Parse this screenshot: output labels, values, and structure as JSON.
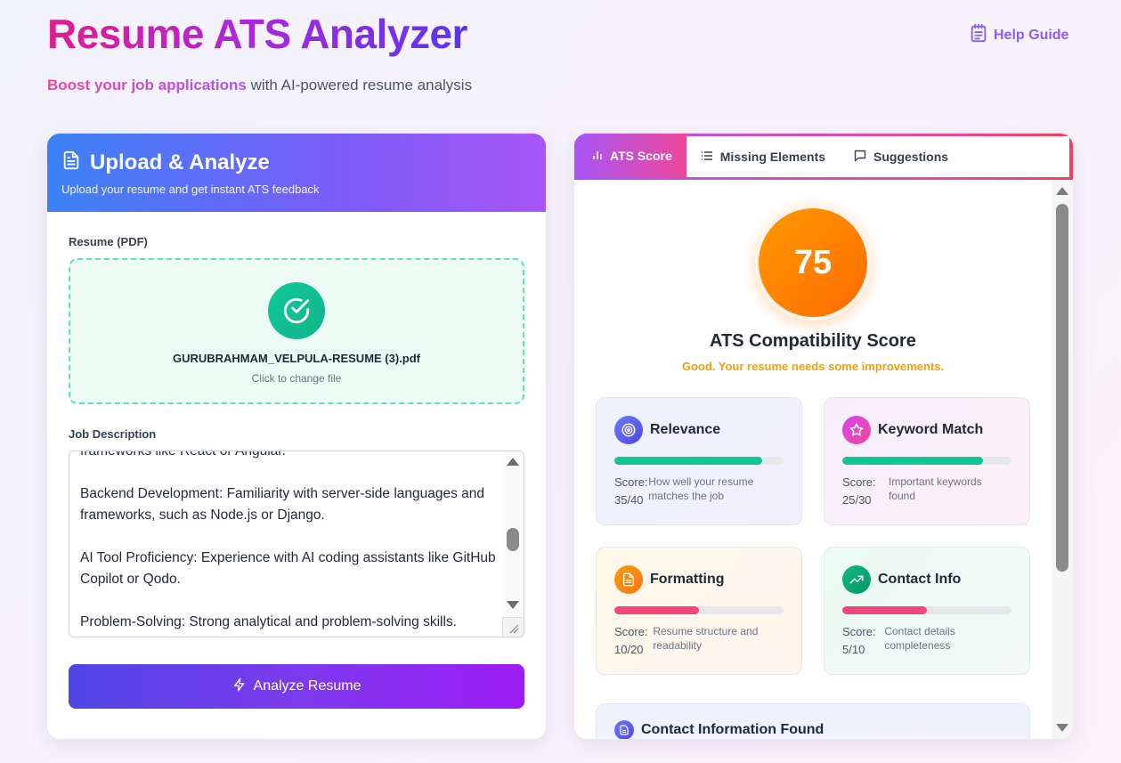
{
  "header": {
    "title": "Resume ATS Analyzer",
    "subtitle_accent": "Boost your job applications",
    "subtitle_rest": " with AI-powered resume analysis",
    "help_label": "Help Guide"
  },
  "upload": {
    "title": "Upload & Analyze",
    "subtitle": "Upload your resume and get instant ATS feedback",
    "resume_label": "Resume (PDF)",
    "file_name": "GURUBRAHMAM_VELPULA-RESUME (3).pdf",
    "change_hint": "Click to change file",
    "jd_label": "Job Description",
    "jd_text": "frameworks like React or Angular.\n\nBackend Development: Familiarity with server-side languages and frameworks, such as Node.js or Django.\n\nAI Tool Proficiency: Experience with AI coding assistants like GitHub Copilot or Qodo.\n\nProblem-Solving: Strong analytical and problem-solving skills.",
    "analyze_label": "Analyze Resume"
  },
  "results": {
    "tabs": [
      {
        "label": "ATS Score",
        "icon": "bar-chart-icon",
        "active": true
      },
      {
        "label": "Missing Elements",
        "icon": "list-icon",
        "active": false
      },
      {
        "label": "Suggestions",
        "icon": "message-icon",
        "active": false
      }
    ],
    "score": "75",
    "score_title": "ATS Compatibility Score",
    "score_message": "Good. Your resume needs some improvements.",
    "metrics": [
      {
        "name": "Relevance",
        "score_label": "Score:",
        "score": "35/40",
        "fraction": 0.875,
        "description": "How well your resume matches the job",
        "icon": "target-icon",
        "bar_color": "#10c493",
        "accent": "#6366f1"
      },
      {
        "name": "Keyword Match",
        "score_label": "Score:",
        "score": "25/30",
        "fraction": 0.833,
        "description": "Important keywords found",
        "icon": "star-icon",
        "bar_color": "#10c493",
        "accent": "#d946ef"
      },
      {
        "name": "Formatting",
        "score_label": "Score:",
        "score": "10/20",
        "fraction": 0.5,
        "description": "Resume structure and readability",
        "icon": "document-icon",
        "bar_color": "#f0467c",
        "accent": "#f97316"
      },
      {
        "name": "Contact Info",
        "score_label": "Score:",
        "score": "5/10",
        "fraction": 0.5,
        "description": "Contact details completeness",
        "icon": "trending-up-icon",
        "bar_color": "#f0467c",
        "accent": "#10b981"
      }
    ],
    "contact_found_title": "Contact Information Found"
  }
}
